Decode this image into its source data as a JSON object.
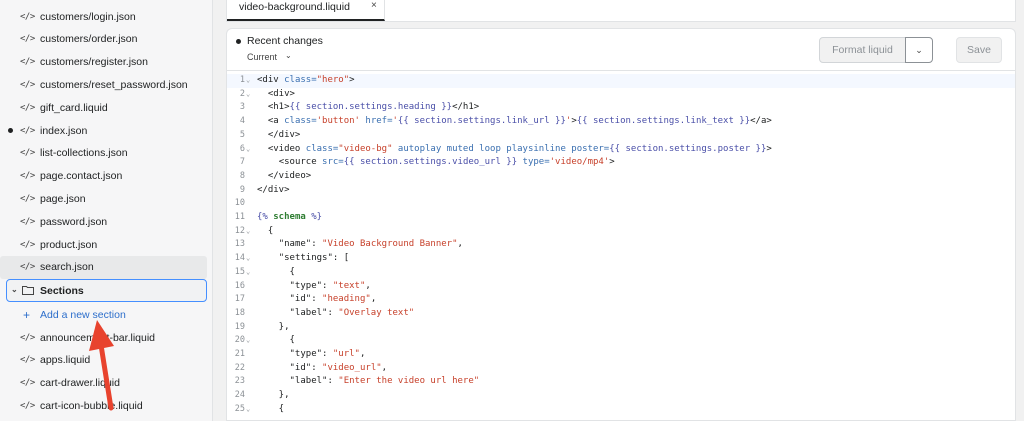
{
  "sidebar": {
    "files_top": [
      {
        "name": "customers/login.json",
        "dot": false,
        "selected": false
      },
      {
        "name": "customers/order.json",
        "dot": false,
        "selected": false
      },
      {
        "name": "customers/register.json",
        "dot": false,
        "selected": false
      },
      {
        "name": "customers/reset_password.json",
        "dot": false,
        "selected": false
      },
      {
        "name": "gift_card.liquid",
        "dot": false,
        "selected": false
      },
      {
        "name": "index.json",
        "dot": true,
        "selected": false
      },
      {
        "name": "list-collections.json",
        "dot": false,
        "selected": false
      },
      {
        "name": "page.contact.json",
        "dot": false,
        "selected": false
      },
      {
        "name": "page.json",
        "dot": false,
        "selected": false
      },
      {
        "name": "password.json",
        "dot": false,
        "selected": false
      },
      {
        "name": "product.json",
        "dot": false,
        "selected": false
      },
      {
        "name": "search.json",
        "dot": false,
        "selected": true
      }
    ],
    "folder": {
      "name": "Sections",
      "expanded": true
    },
    "add_section_label": "Add a new section",
    "files_bottom": [
      {
        "name": "announcement-bar.liquid"
      },
      {
        "name": "apps.liquid"
      },
      {
        "name": "cart-drawer.liquid"
      },
      {
        "name": "cart-icon-bubble.liquid"
      }
    ],
    "code_icon": "</>"
  },
  "tab": {
    "label": "video-background.liquid",
    "close": "×"
  },
  "toolbar": {
    "recent_changes": "Recent changes",
    "current": "Current",
    "format_label": "Format liquid",
    "save_label": "Save"
  },
  "code_lines": [
    {
      "n": "1",
      "fold": true,
      "html": "<span class='tag'>&lt;div</span> <span class='attr'>class=</span><span class='str'>\"hero\"</span><span class='tag'>&gt;</span>"
    },
    {
      "n": "2",
      "fold": true,
      "html": "  <span class='tag'>&lt;div&gt;</span>"
    },
    {
      "n": "3",
      "fold": false,
      "html": "  <span class='tag'>&lt;h1&gt;</span><span class='tpl'>{{ section.settings.heading }}</span><span class='tag'>&lt;/h1&gt;</span>"
    },
    {
      "n": "4",
      "fold": false,
      "html": "  <span class='tag'>&lt;a</span> <span class='attr'>class=</span><span class='str'>'button'</span> <span class='attr'>href=</span><span class='str'>'</span><span class='tpl'>{{ section.settings.link_url }}</span><span class='str'>'</span><span class='tag'>&gt;</span><span class='tpl'>{{ section.settings.link_text }}</span><span class='tag'>&lt;/a&gt;</span>"
    },
    {
      "n": "5",
      "fold": false,
      "html": "  <span class='tag'>&lt;/div&gt;</span>"
    },
    {
      "n": "6",
      "fold": true,
      "html": "  <span class='tag'>&lt;video</span> <span class='attr'>class=</span><span class='str'>\"video-bg\"</span> <span class='attr'>autoplay muted loop playsinline poster=</span><span class='tpl'>{{ section.settings.poster }}</span><span class='tag'>&gt;</span>"
    },
    {
      "n": "7",
      "fold": false,
      "html": "    <span class='tag'>&lt;source</span> <span class='attr'>src=</span><span class='tpl'>{{ section.settings.video_url }}</span> <span class='attr'>type=</span><span class='str'>'video/mp4'</span><span class='tag'>&gt;</span>"
    },
    {
      "n": "8",
      "fold": false,
      "html": "  <span class='tag'>&lt;/video&gt;</span>"
    },
    {
      "n": "9",
      "fold": false,
      "html": "<span class='tag'>&lt;/div&gt;</span>"
    },
    {
      "n": "10",
      "fold": false,
      "html": ""
    },
    {
      "n": "11",
      "fold": false,
      "html": "<span class='tpl'>{%</span> <span class='kw'>schema</span> <span class='tpl'>%}</span>"
    },
    {
      "n": "12",
      "fold": true,
      "html": "  {"
    },
    {
      "n": "13",
      "fold": false,
      "html": "    <span class='key'>\"name\"</span>: <span class='str'>\"Video Background Banner\"</span>,"
    },
    {
      "n": "14",
      "fold": true,
      "html": "    <span class='key'>\"settings\"</span>: ["
    },
    {
      "n": "15",
      "fold": true,
      "html": "      {"
    },
    {
      "n": "16",
      "fold": false,
      "html": "      <span class='key'>\"type\"</span>: <span class='str'>\"text\"</span>,"
    },
    {
      "n": "17",
      "fold": false,
      "html": "      <span class='key'>\"id\"</span>: <span class='str'>\"heading\"</span>,"
    },
    {
      "n": "18",
      "fold": false,
      "html": "      <span class='key'>\"label\"</span>: <span class='str'>\"Overlay text\"</span>"
    },
    {
      "n": "19",
      "fold": false,
      "html": "    },"
    },
    {
      "n": "20",
      "fold": true,
      "html": "      {"
    },
    {
      "n": "21",
      "fold": false,
      "html": "      <span class='key'>\"type\"</span>: <span class='str'>\"url\"</span>,"
    },
    {
      "n": "22",
      "fold": false,
      "html": "      <span class='key'>\"id\"</span>: <span class='str'>\"video_url\"</span>,"
    },
    {
      "n": "23",
      "fold": false,
      "html": "      <span class='key'>\"label\"</span>: <span class='str'>\"Enter the video url here\"</span>"
    },
    {
      "n": "24",
      "fold": false,
      "html": "    },"
    },
    {
      "n": "25",
      "fold": true,
      "html": "    {"
    }
  ],
  "colors": {
    "accent": "#458fff",
    "arrow": "#e8432e",
    "link": "#2c6ecb"
  }
}
